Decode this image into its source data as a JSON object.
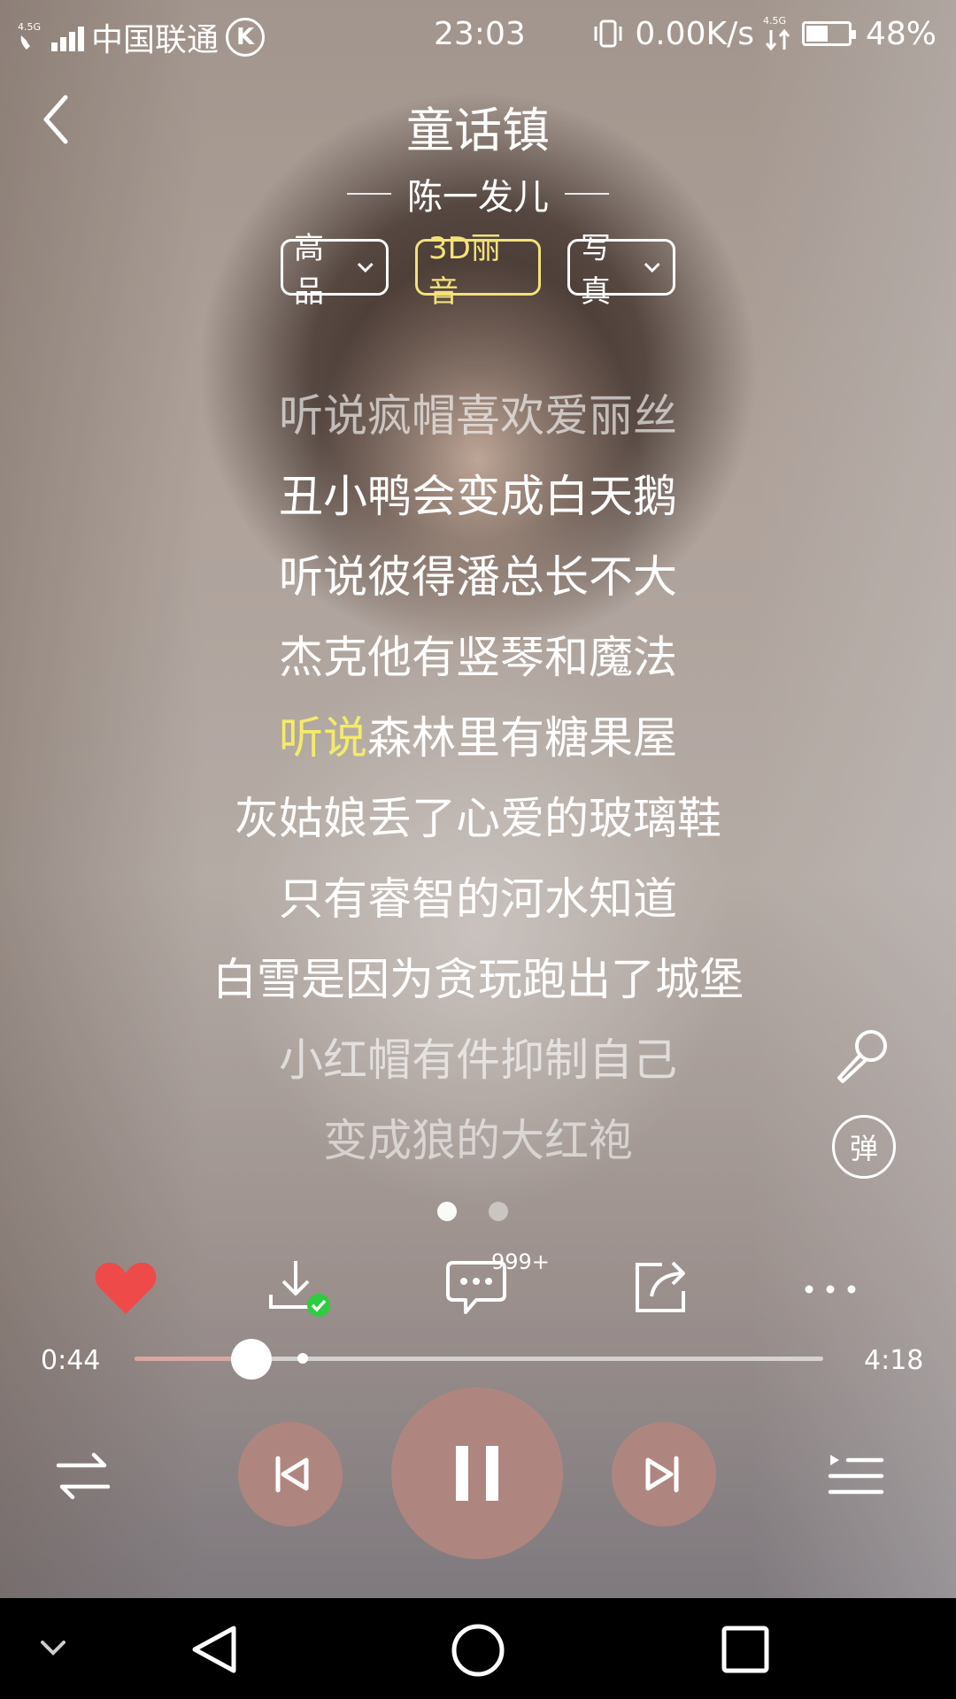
{
  "status_bar": {
    "net_type_small": "4.5G",
    "carrier": "中国联通",
    "carrier_badge": "K",
    "time": "23:03",
    "speed": "0.00K/s",
    "net_type_right": "4.5G",
    "battery_percent": "48%"
  },
  "song": {
    "title": "童话镇",
    "artist": "陈一发儿"
  },
  "chips": {
    "quality": "高品",
    "sound": "3D丽音",
    "photo": "写真"
  },
  "lyrics": {
    "line1": "听说疯帽喜欢爱丽丝",
    "line2": "丑小鸭会变成白天鹅",
    "line3": "听说彼得潘总长不大",
    "line4": "杰克他有竖琴和魔法",
    "line5_highlight": "听说",
    "line5_rest": "森林里有糖果屋",
    "line6": "灰姑娘丢了心爱的玻璃鞋",
    "line7": "只有睿智的河水知道",
    "line8": "白雪是因为贪玩跑出了城堡",
    "line9": "小红帽有件抑制自己",
    "line10": "变成狼的大红袍"
  },
  "danmu_label": "弹",
  "comments_badge": "999+",
  "progress": {
    "elapsed": "0:44",
    "duration": "4:18",
    "played_fraction": 0.17
  },
  "colors": {
    "lyric_highlight": "#f4ea6c",
    "chip_gold": "#f3e27a",
    "like_red": "#ef4a4a",
    "control_bg": "#b2867e",
    "download_check": "#2ecc40"
  }
}
